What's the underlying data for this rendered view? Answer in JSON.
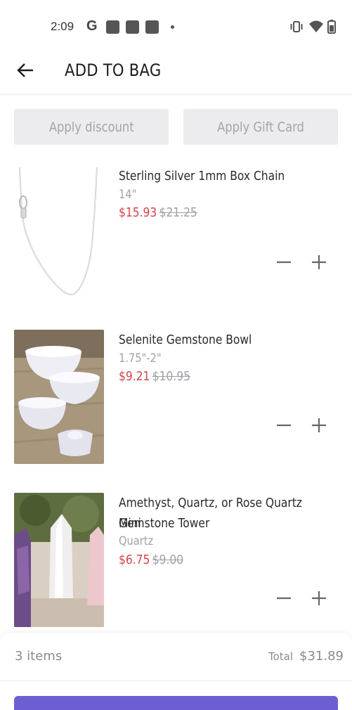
{
  "status_bar": {
    "time": "2:09",
    "g_label": "G"
  },
  "header": {
    "title": "ADD TO BAG"
  },
  "actions": {
    "discount_label": "Apply discount",
    "gift_card_label": "Apply Gift Card"
  },
  "items": [
    {
      "title": "Sterling Silver 1mm Box Chain",
      "variant": "14\"",
      "sale_price": "$15.93",
      "original_price": "$21.25"
    },
    {
      "title": "Selenite Gemstone Bowl",
      "variant": "1.75\"-2\"",
      "sale_price": "$9.21",
      "original_price": "$10.95"
    },
    {
      "title_line1": "Amethyst, Quartz, or Rose Quartz Mini",
      "title_line2": "Gemstone Tower",
      "variant": "Quartz",
      "sale_price": "$6.75",
      "original_price": "$9.00"
    }
  ],
  "footer": {
    "items_count": "3 items",
    "total_label": "Total",
    "total_value": "$31.89"
  },
  "colors": {
    "sale_price": "#d4444a",
    "accent": "#6c5fd3",
    "button_bg": "#ececef"
  },
  "icons": [
    "back-arrow-icon",
    "minus-icon",
    "plus-icon",
    "vibrate-icon",
    "wifi-icon",
    "battery-icon"
  ]
}
